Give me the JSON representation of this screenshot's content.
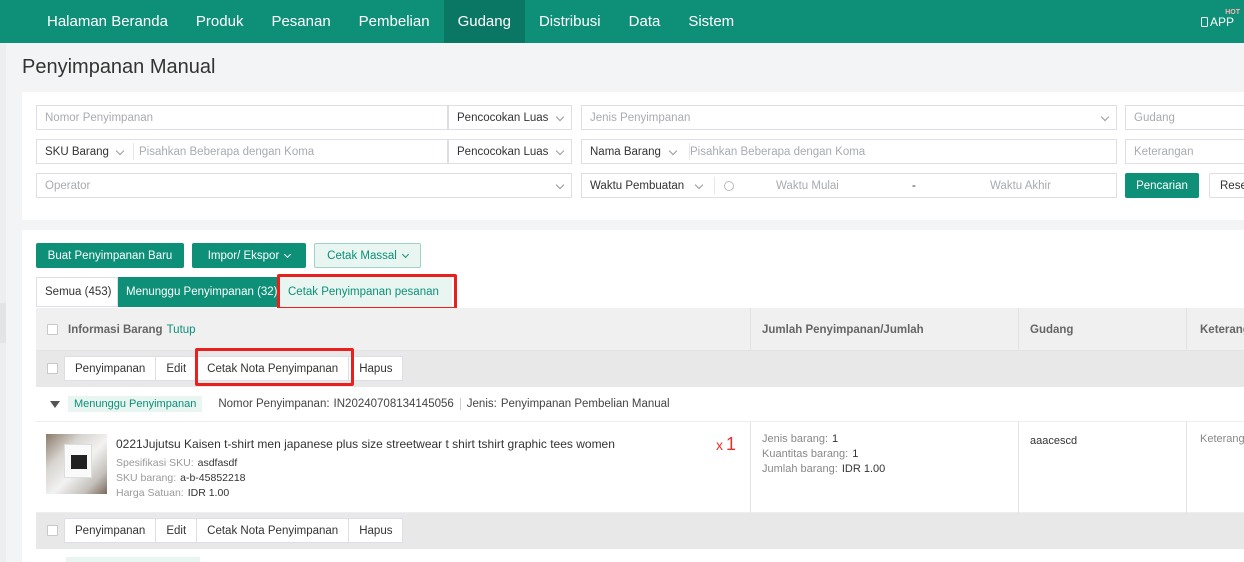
{
  "nav": {
    "items": [
      "Halaman Beranda",
      "Produk",
      "Pesanan",
      "Pembelian",
      "Gudang",
      "Distribusi",
      "Data",
      "Sistem"
    ],
    "active_index": 4,
    "app_label": "APP",
    "app_badge": "HOT",
    "app_icon": "phone-icon"
  },
  "page": {
    "title": "Penyimpanan Manual"
  },
  "filters": {
    "nomor_placeholder": "Nomor Penyimpanan",
    "match_mode_1": "Pencocokan Luas",
    "jenis_placeholder": "Jenis Penyimpanan",
    "gudang_placeholder": "Gudang",
    "sku_select": "SKU Barang",
    "sku_placeholder": "Pisahkan Beberapa dengan Koma",
    "match_mode_2": "Pencocokan Luas",
    "nama_select": "Nama Barang",
    "nama_placeholder": "Pisahkan Beberapa dengan Koma",
    "keterangan_placeholder": "Keterangan",
    "operator_placeholder": "Operator",
    "time_select": "Waktu Pembuatan",
    "time_start": "Waktu Mulai",
    "time_sep": "-",
    "time_end": "Waktu Akhir",
    "search_button": "Pencarian",
    "reset_button": "Reset"
  },
  "actions": {
    "create": "Buat Penyimpanan Baru",
    "import_export": "Impor/ Ekspor",
    "bulk_print": "Cetak Massal"
  },
  "tabs": [
    {
      "label": "Semua (453)"
    },
    {
      "label": "Menunggu Penyimpanan (32)"
    },
    {
      "label": "Cetak Penyimpanan pesanan"
    }
  ],
  "table": {
    "col_info": "Informasi Barang",
    "col_info_toggle": "Tutup",
    "col_qty": "Jumlah Penyimpanan/Jumlah",
    "col_gudang": "Gudang",
    "col_keterangan": "Keterangan"
  },
  "row_ops": [
    "Penyimpanan",
    "Edit",
    "Cetak Nota Penyimpanan",
    "Hapus"
  ],
  "order": {
    "status": "Menunggu Penyimpanan",
    "number_label": "Nomor Penyimpanan:",
    "number": "IN20240708134145056",
    "type_label": "Jenis:",
    "type": "Penyimpanan Pembelian Manual",
    "item": {
      "name": "0221Jujutsu Kaisen t-shirt men japanese plus size streetwear t shirt tshirt graphic tees women",
      "spec_label": "Spesifikasi SKU:",
      "spec": "asdfasdf",
      "sku_label": "SKU barang:",
      "sku": "a-b-45852218",
      "price_label": "Harga Satuan:",
      "price": "IDR 1.00",
      "qty_prefix": "x",
      "qty": "1"
    },
    "summary": {
      "jenis_label": "Jenis barang:",
      "jenis": "1",
      "kuantitas_label": "Kuantitas barang:",
      "kuantitas": "1",
      "jumlah_label": "Jumlah barang:",
      "jumlah": "IDR 1.00"
    },
    "gudang": "aaacescd",
    "keterangan": "Keterangan"
  }
}
